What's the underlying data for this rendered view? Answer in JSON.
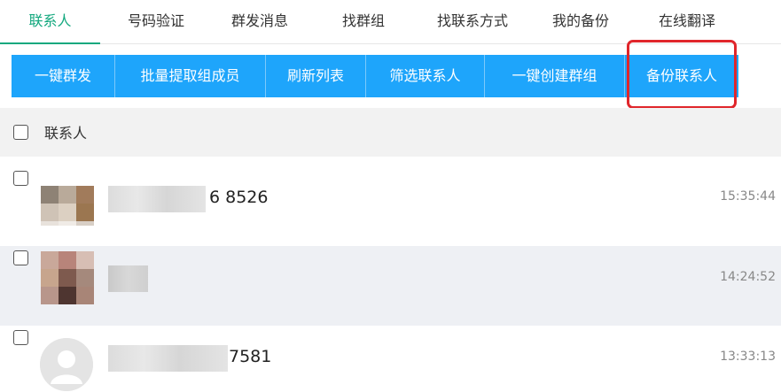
{
  "tabs": [
    {
      "label": "联系人",
      "active": true
    },
    {
      "label": "号码验证",
      "active": false
    },
    {
      "label": "群发消息",
      "active": false
    },
    {
      "label": "找群组",
      "active": false
    },
    {
      "label": "找联系方式",
      "active": false
    },
    {
      "label": "我的备份",
      "active": false
    },
    {
      "label": "在线翻译",
      "active": false
    }
  ],
  "toolbar": {
    "buttons": [
      "一键群发",
      "批量提取组成员",
      "刷新列表",
      "筛选联系人",
      "一键创建群组",
      "备份联系人"
    ],
    "highlighted": "备份联系人"
  },
  "list_header": {
    "label": "联系人"
  },
  "contacts": [
    {
      "name_visible": "6 8526",
      "time": "15:35:44"
    },
    {
      "name_visible": "",
      "time": "14:24:52"
    },
    {
      "name_visible": "7581",
      "time": "13:33:13"
    }
  ],
  "colors": {
    "accent_green": "#13a87e",
    "button_blue": "#1ea5fb",
    "highlight_red": "#e0262b"
  }
}
